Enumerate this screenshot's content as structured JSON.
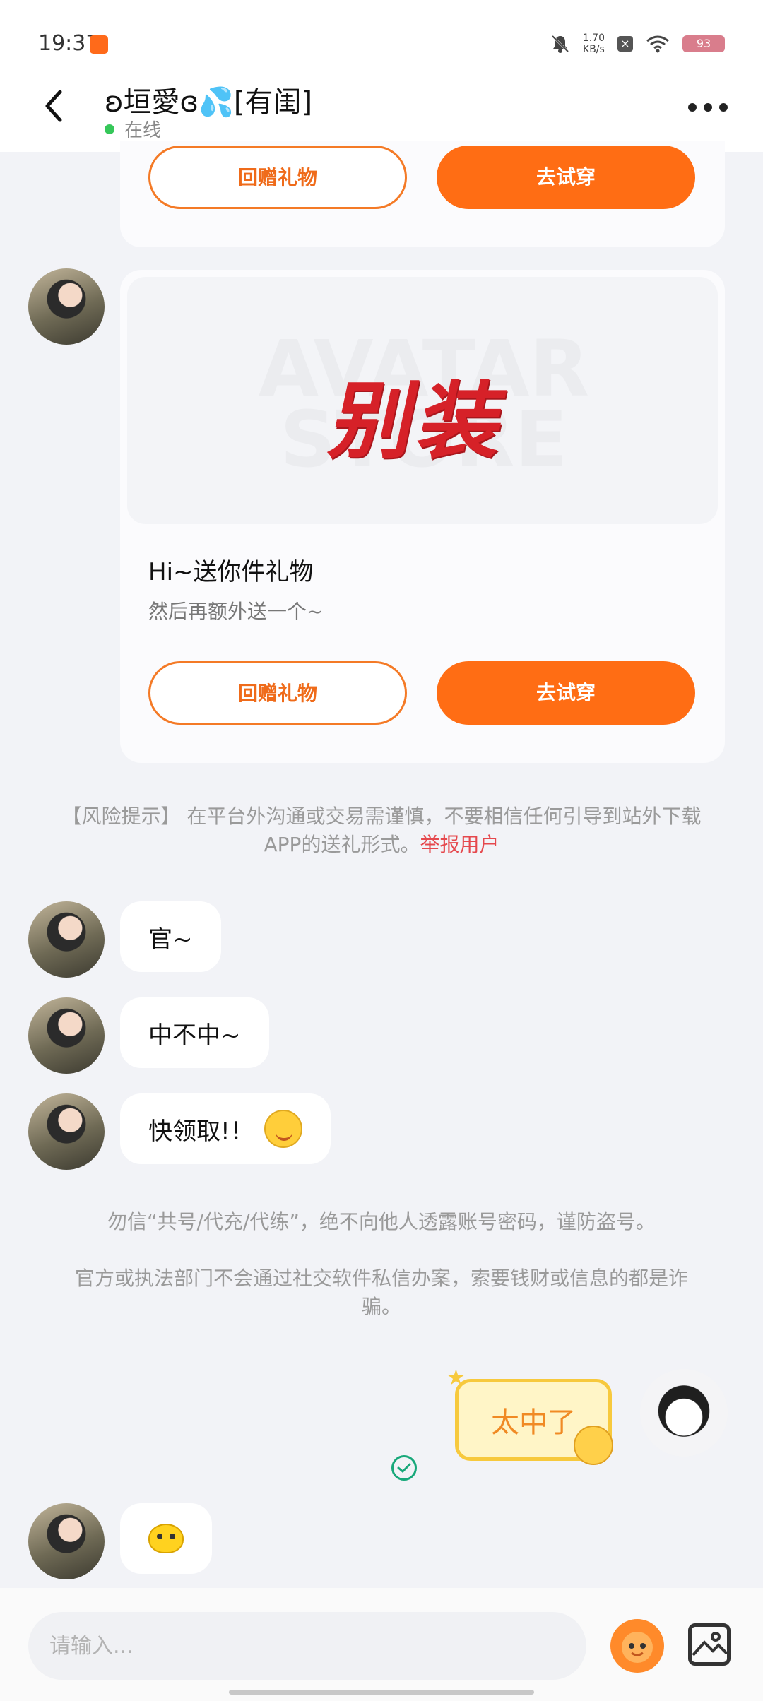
{
  "status_bar": {
    "time": "19:37",
    "net_speed": "1.70",
    "net_unit": "KB/s",
    "battery": "93"
  },
  "header": {
    "title": "ʚ垣愛ɞ💦[有闺]",
    "status": "在线"
  },
  "gift_card_top": {
    "return_gift": "回赠礼物",
    "try_on": "去试穿"
  },
  "gift_card": {
    "banner_text": "别装",
    "banner_watermark": "AVATAR STORE",
    "title": "Hi~送你件礼物",
    "subtitle": "然后再额外送一个~",
    "return_gift": "回赠礼物",
    "try_on": "去试穿"
  },
  "risk_notice": {
    "text": "【风险提示】 在平台外沟通或交易需谨慎，不要相信任何引导到站外下载APP的送礼形式。",
    "link": "举报用户"
  },
  "messages": [
    {
      "text": "官~"
    },
    {
      "text": "中不中~"
    },
    {
      "text": "快领取!！"
    }
  ],
  "safety_notes": {
    "line1": "勿信“共号/代充/代练”，绝不向他人透露账号密码，谨防盗号。",
    "line2": "官方或执法部门不会通过社交软件私信办案，索要钱财或信息的都是诈骗。"
  },
  "sticker": {
    "text": "太中了"
  },
  "input": {
    "placeholder": "请输入..."
  },
  "colors": {
    "accent": "#ff6d14",
    "link_red": "#e5484d",
    "online_green": "#35c759",
    "sent_check": "#18a87a"
  }
}
